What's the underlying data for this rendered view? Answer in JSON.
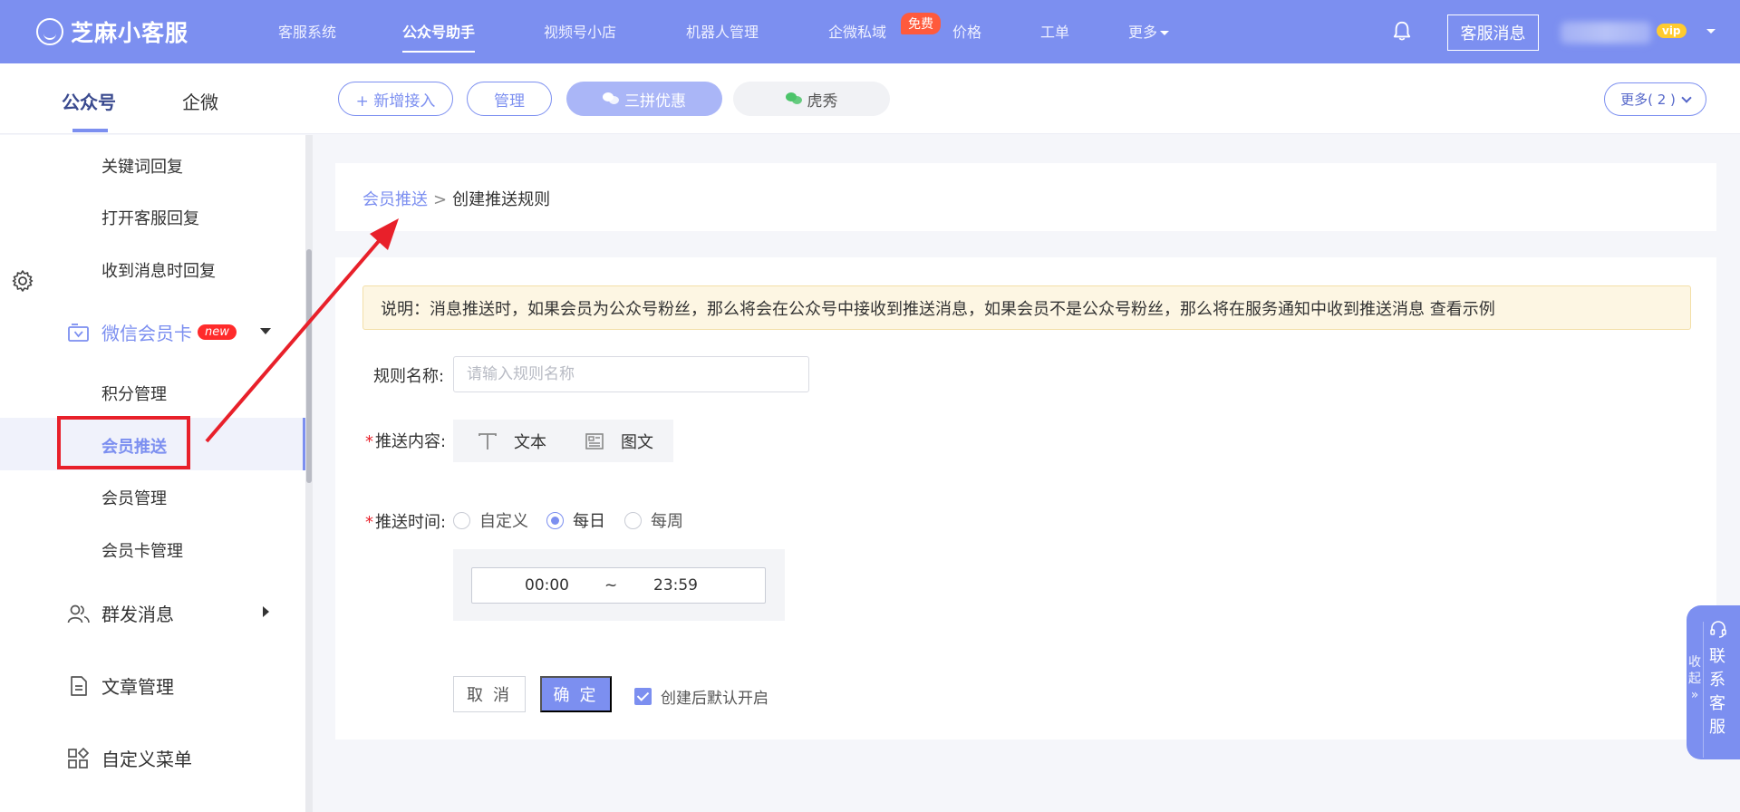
{
  "topbar": {
    "logo_text": "芝麻小客服",
    "nav": [
      "客服系统",
      "公众号助手",
      "视频号小店",
      "机器人管理",
      "企微私域",
      "价格",
      "工单",
      "更多"
    ],
    "free_badge": "免费",
    "service_button": "客服消息",
    "vip_badge": "vip"
  },
  "subbar": {
    "tabs": [
      "公众号",
      "企微"
    ],
    "add_button": "+ 新增接入",
    "manage_button": "管理",
    "accounts": [
      "三拼优惠",
      "虎秀"
    ],
    "more_button": "更多( 2 )"
  },
  "sidebar": {
    "items": [
      {
        "label": "关键词回复"
      },
      {
        "label": "打开客服回复"
      },
      {
        "label": "收到消息时回复"
      },
      {
        "label": "微信会员卡",
        "badge": "new"
      },
      {
        "label": "积分管理"
      },
      {
        "label": "会员推送"
      },
      {
        "label": "会员管理"
      },
      {
        "label": "会员卡管理"
      },
      {
        "label": "群发消息"
      },
      {
        "label": "文章管理"
      },
      {
        "label": "自定义菜单"
      }
    ]
  },
  "breadcrumb": {
    "parent": "会员推送",
    "separator": ">",
    "current": "创建推送规则"
  },
  "form": {
    "notice": "说明：消息推送时，如果会员为公众号粉丝，那么将会在公众号中接收到推送消息，如果会员不是公众号粉丝，那么将在服务通知中收到推送消息 查看示例",
    "rule_name_label": "规则名称:",
    "rule_name_placeholder": "请输入规则名称",
    "rule_name_value": "",
    "required_mark": "*",
    "content_label": "推送内容:",
    "content_types": [
      "文本",
      "图文"
    ],
    "time_label": "推送时间:",
    "time_options": [
      "自定义",
      "每日",
      "每周"
    ],
    "time_selected": "每日",
    "time_start": "00:00",
    "time_separator": "~",
    "time_end": "23:59",
    "cancel_button": "取 消",
    "confirm_button": "确 定",
    "default_enable_label": "创建后默认开启",
    "default_enable_checked": true
  },
  "float_panel": {
    "collapse_label": "收起",
    "collapse_glyph": "»",
    "contact_label": "联系客服"
  },
  "colors": {
    "primary": "#7c8ff0",
    "highlight_box": "#e8202a",
    "badge_red": "#ff2b2b",
    "free_badge": "#ff5a3c",
    "notice_bg": "#fdf6e3"
  }
}
